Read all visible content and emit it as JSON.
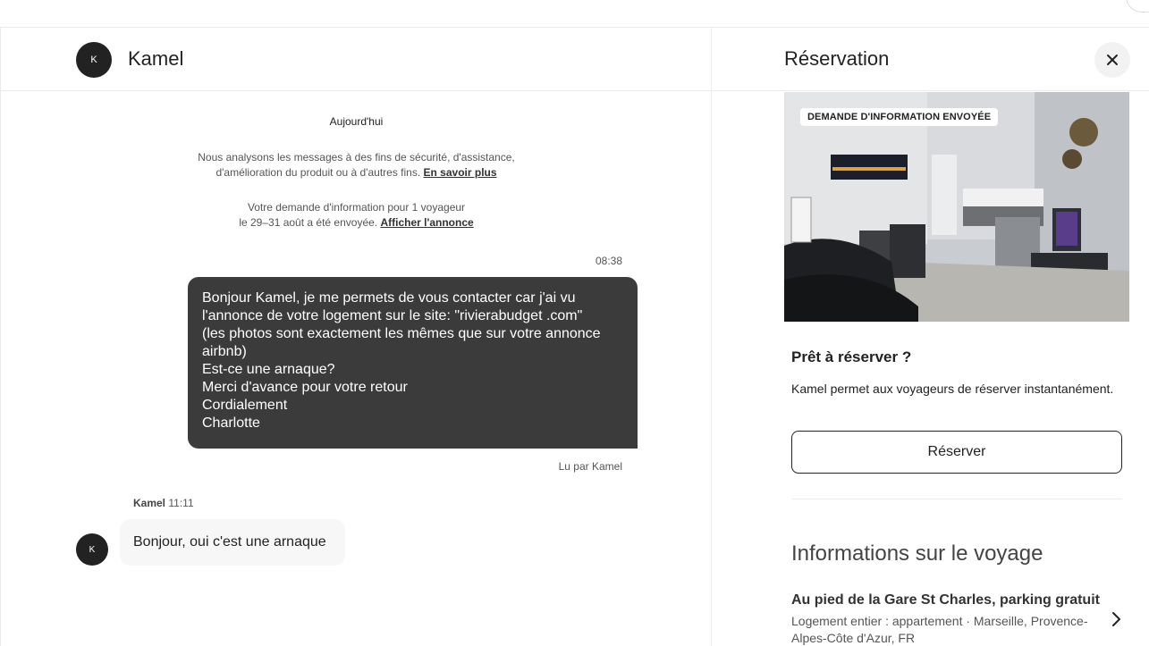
{
  "chat": {
    "contact_name": "Kamel",
    "avatar_initial": "K",
    "day_label": "Aujourd'hui",
    "privacy_notice": {
      "line1": "Nous analysons les messages à des fins de sécurité, d'assistance,",
      "line2": "d'amélioration du produit ou à d'autres fins.",
      "link": "En savoir plus"
    },
    "request_notice": {
      "line1": "Votre demande d'information pour 1 voyageur",
      "line2": "le 29–31 août a été envoyée.",
      "link": "Afficher l'annonce"
    },
    "outgoing_time": "08:38",
    "outgoing_message": "Bonjour Kamel, je me permets de vous contacter car j'ai vu\nl'annonce de votre logement sur le site: \"rivierabudget .com\"\n(les photos sont exactement les mêmes que sur votre annonce\nairbnb)\nEst-ce une arnaque?\nMerci d'avance pour votre retour\nCordialement\nCharlotte",
    "read_receipt": "Lu par Kamel",
    "incoming": {
      "sender": "Kamel",
      "time": "11:11",
      "text": "Bonjour, oui c'est une arnaque"
    }
  },
  "panel": {
    "title": "Réservation",
    "close_icon": "close-icon",
    "photo_badge": "DEMANDE D'INFORMATION ENVOYÉE",
    "ready_title": "Prêt à réserver ?",
    "ready_text": "Kamel permet aux voyageurs de réserver instantanément.",
    "reserve_label": "Réserver",
    "trip_title": "Informations sur le voyage",
    "listing_title": "Au pied de la Gare St Charles, parking gratuit",
    "listing_sub": "Logement entier : appartement · Marseille, Provence-Alpes-Côte d'Azur, FR"
  },
  "colors": {
    "outgoing_bubble": "#3b3b3b",
    "incoming_bubble": "#f7f7f7",
    "avatar": "#222222",
    "border": "#ebebeb"
  }
}
